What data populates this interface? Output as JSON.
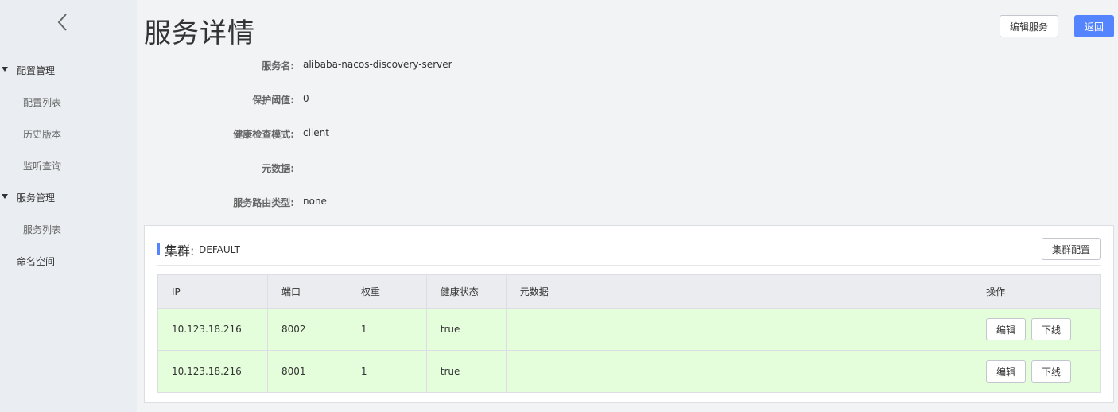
{
  "sidebar": {
    "groups": [
      {
        "label": "配置管理",
        "items": [
          "配置列表",
          "历史版本",
          "监听查询"
        ]
      },
      {
        "label": "服务管理",
        "items": [
          "服务列表"
        ]
      }
    ],
    "top_item": "命名空间"
  },
  "header": {
    "title": "服务详情",
    "edit_button": "编辑服务",
    "back_button": "返回",
    "accent_color": "#5584ff"
  },
  "details": [
    {
      "label": "服务名:",
      "value": "alibaba-nacos-discovery-server"
    },
    {
      "label": "保护阈值:",
      "value": "0"
    },
    {
      "label": "健康检查模式:",
      "value": "client"
    },
    {
      "label": "元数据:",
      "value": ""
    },
    {
      "label": "服务路由类型:",
      "value": "none"
    }
  ],
  "cluster": {
    "title": "集群:",
    "name": "DEFAULT",
    "config_button": "集群配置",
    "columns": [
      "IP",
      "端口",
      "权重",
      "健康状态",
      "元数据",
      "操作"
    ],
    "rows": [
      {
        "ip": "10.123.18.216",
        "port": "8002",
        "weight": "1",
        "healthy": "true",
        "metadata": ""
      },
      {
        "ip": "10.123.18.216",
        "port": "8001",
        "weight": "1",
        "healthy": "true",
        "metadata": ""
      }
    ],
    "edit_label": "编辑",
    "offline_label": "下线",
    "healthy_row_color": "#e4fdda"
  }
}
